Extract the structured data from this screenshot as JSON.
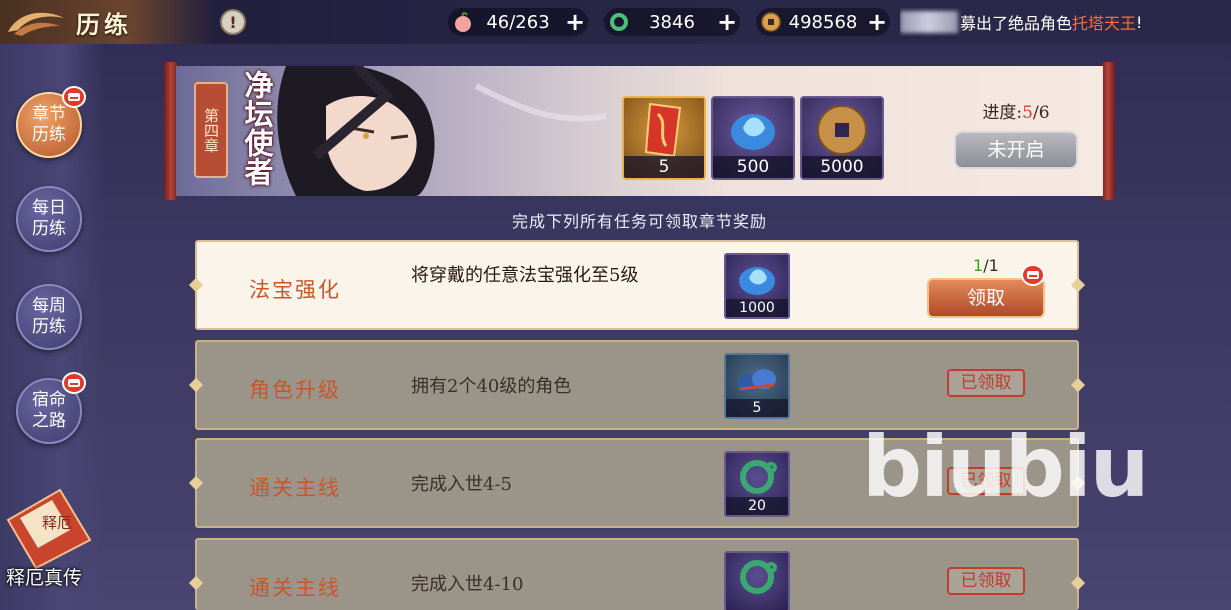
{
  "header": {
    "title": "历练",
    "info_icon": "!",
    "resources": [
      {
        "icon": "peach-icon",
        "value": "46/263",
        "plus": "+"
      },
      {
        "icon": "jade-ring-icon",
        "value": "3846",
        "plus": "+"
      },
      {
        "icon": "coin-icon",
        "value": "498568",
        "plus": "+"
      }
    ],
    "ticker": {
      "prefix": "募出了绝品角色",
      "highlight": "托塔天王",
      "suffix": "!"
    }
  },
  "sidebar": {
    "items": [
      {
        "label": "章节历练",
        "active": true,
        "badge": true
      },
      {
        "label": "每日历练",
        "active": false,
        "badge": false
      },
      {
        "label": "每周历练",
        "active": false,
        "badge": false
      },
      {
        "label": "宿命之路",
        "active": false,
        "badge": true
      }
    ],
    "promo": {
      "label": "释厄真传",
      "book_text": "释厄"
    }
  },
  "chapter": {
    "tag": "第四章",
    "name": "净坛使者",
    "rewards": [
      {
        "icon": "red-talisman-icon",
        "count": "5"
      },
      {
        "icon": "blue-spirit-flame-icon",
        "count": "500"
      },
      {
        "icon": "copper-coin-icon",
        "count": "5000"
      }
    ],
    "progress_label": "进度:",
    "progress_current": "5",
    "progress_total": "/6",
    "button": "未开启"
  },
  "hint": "完成下列所有任务可领取章节奖励",
  "tasks": [
    {
      "name": "法宝强化",
      "desc": "将穿戴的任意法宝强化至5级",
      "reward_icon": "blue-spirit-flame-icon",
      "reward_count": "1000",
      "progress_done": "1",
      "progress_total": "/1",
      "action": "领取"
    },
    {
      "name": "角色升级",
      "desc": "拥有2个40级的角色",
      "reward_icon": "blue-gem-bag-icon",
      "reward_count": "5",
      "status": "已领取"
    },
    {
      "name": "通关主线",
      "desc": "完成入世4-5",
      "reward_icon": "jade-ring-icon",
      "reward_count": "20",
      "status": "已领取"
    },
    {
      "name": "通关主线",
      "desc": "完成入世4-10",
      "reward_icon": "jade-ring-icon",
      "reward_count": "",
      "status": "已领取"
    }
  ],
  "watermark": "biubiu",
  "colors": {
    "accent": "#c9562a",
    "highlight": "#ff6a3a",
    "progress_red": "#e03a2a",
    "progress_green": "#3aa020"
  }
}
